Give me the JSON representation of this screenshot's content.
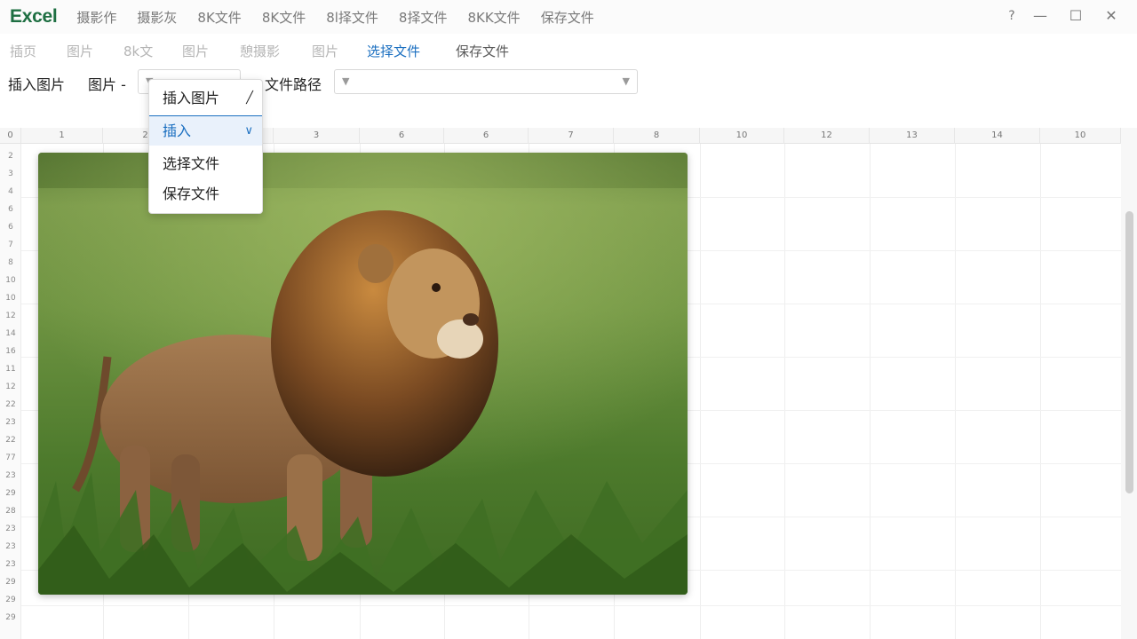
{
  "app": {
    "name": "Excel"
  },
  "title_tabs": [
    "摄影作",
    "摄影灰",
    "8K文件",
    "8K文件",
    "8l择文件",
    "8择文件",
    "8KK文件",
    "保存文件"
  ],
  "window_controls": {
    "help": "?",
    "minimize": "—",
    "maximize": "☐",
    "close": "✕"
  },
  "ribbon_tabs": [
    "插页",
    "图片",
    "8k文",
    "图片",
    "憩摄影",
    "图片",
    "选择文件",
    "保存文件"
  ],
  "ribbon_active_index": 6,
  "toolbar": {
    "insert_picture_label": "插入图片",
    "picture_label": "图片 -",
    "picture_combo_value": "",
    "file_path_label": "文件路径",
    "file_path_value": ""
  },
  "dropdown": {
    "items": [
      {
        "label": "插入图片",
        "icon": "pen-icon"
      },
      {
        "label": "插入",
        "icon": "chevron-down-icon",
        "selected": true
      },
      {
        "label": "选择文件"
      },
      {
        "label": "保存文件"
      }
    ]
  },
  "sheet": {
    "corner_label": "0",
    "column_labels": [
      "1",
      "2",
      "",
      "3",
      "6",
      "6",
      "7",
      "8",
      "10",
      "12",
      "13",
      "14",
      "10"
    ],
    "row_labels": [
      "2",
      "3",
      "4",
      "6",
      "6",
      "7",
      "8",
      "10",
      "10",
      "12",
      "14",
      "16",
      "11",
      "12",
      "22",
      "23",
      "22",
      "77",
      "23",
      "29",
      "28",
      "23",
      "23",
      "23",
      "29",
      "29",
      "29"
    ]
  },
  "picture": {
    "subject": "lion-in-grass-photo"
  },
  "colors": {
    "brand": "#1e6f42",
    "accent": "#1b6fc0"
  }
}
